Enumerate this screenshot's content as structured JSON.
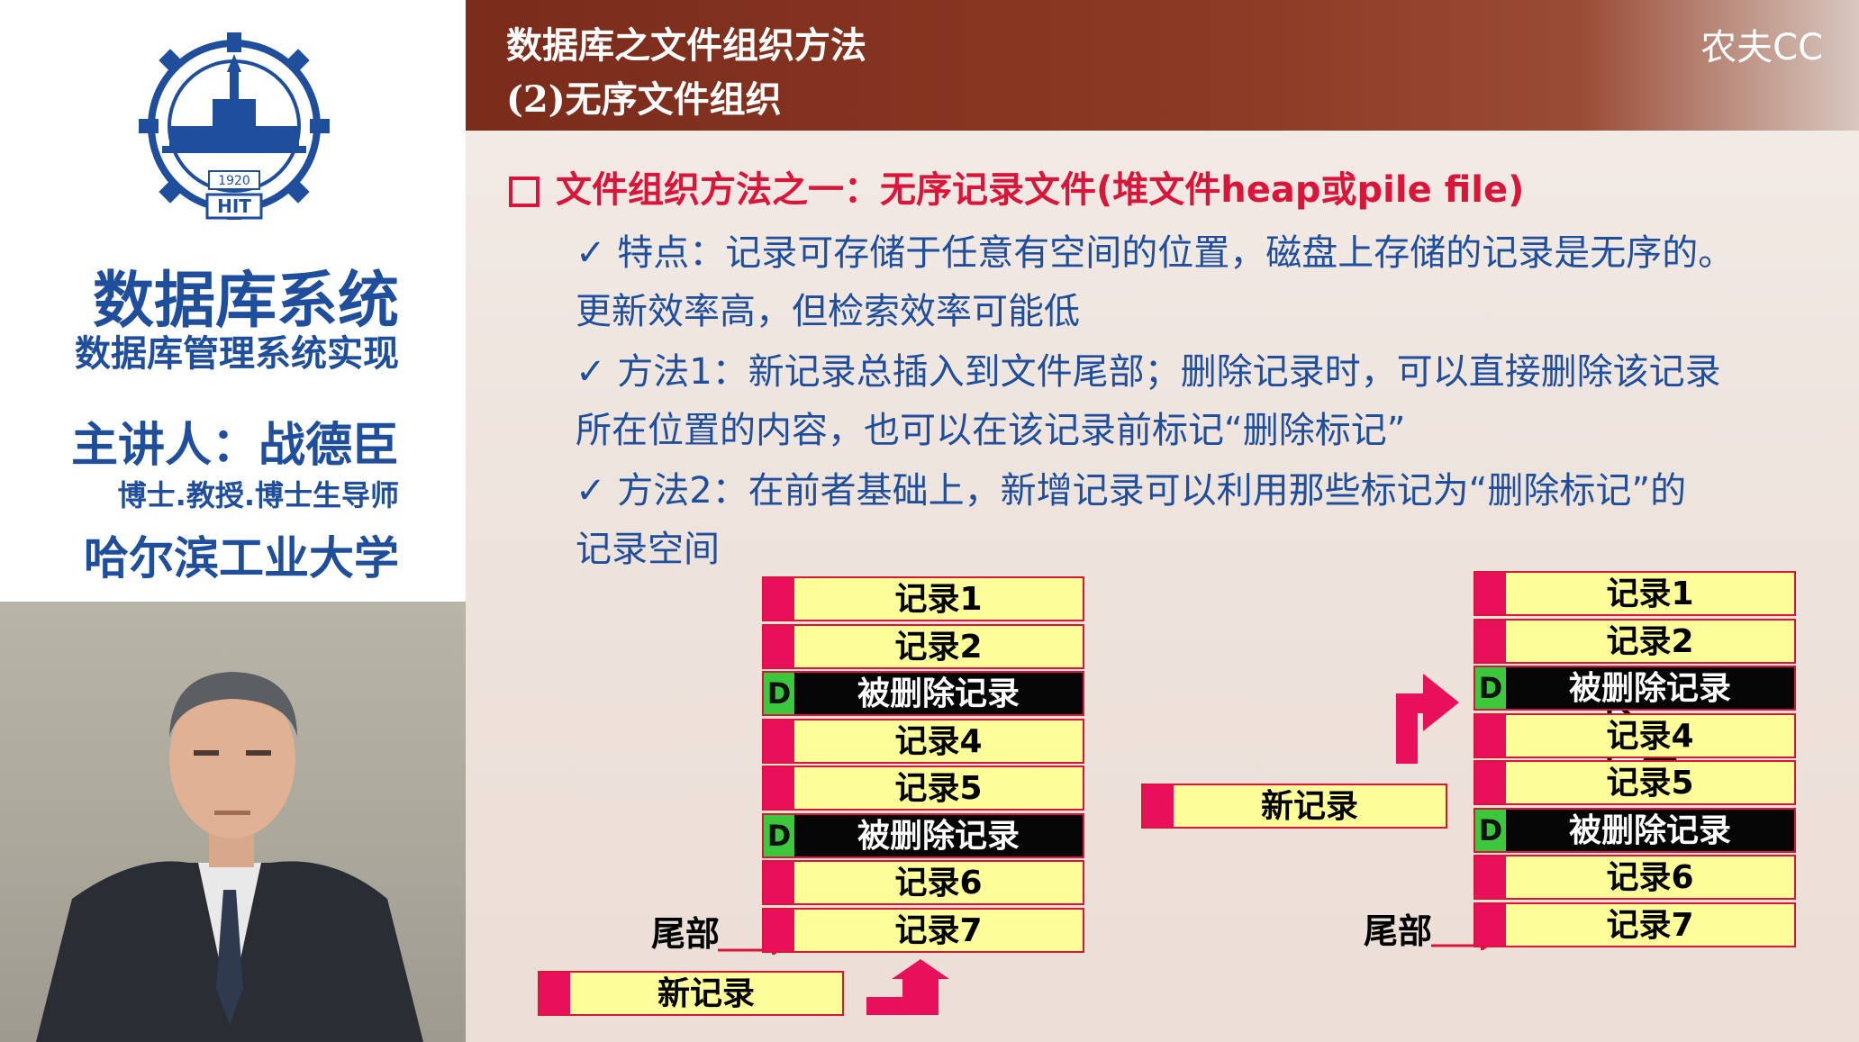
{
  "sidebar": {
    "title": "数据库系统",
    "subtitle": "数据库管理系统实现",
    "lecturer": "主讲人：战德臣",
    "credentials": "博士.教授.博士生导师",
    "university": "哈尔滨工业大学",
    "logo_text": {
      "year": "1920",
      "name": "HIT"
    }
  },
  "slide": {
    "banner_line1": "数据库之文件组织方法",
    "banner_line2": "(2)无序文件组织",
    "watermark": "农夫CC",
    "heading": "文件组织方法之一：无序记录文件(堆文件heap或pile file)",
    "bullets": [
      {
        "line1": "✓ 特点：记录可存储于任意有空间的位置，磁盘上存储的记录是无序的。",
        "line2": "更新效率高，但检索效率可能低"
      },
      {
        "line1": "✓ 方法1：新记录总插入到文件尾部；删除记录时，可以直接删除该记录",
        "line2": "所在位置的内容，也可以在该记录前标记“删除标记”"
      },
      {
        "line1": "✓ 方法2：在前者基础上，新增记录可以利用那些标记为“删除标记”的",
        "line2": "记录空间"
      }
    ]
  },
  "diagram_left": {
    "records": [
      {
        "text": "记录1",
        "deleted": false
      },
      {
        "text": "记录2",
        "deleted": false
      },
      {
        "text": "被删除记录",
        "deleted": true,
        "mark": "D"
      },
      {
        "text": "记录4",
        "deleted": false
      },
      {
        "text": "记录5",
        "deleted": false
      },
      {
        "text": "被删除记录",
        "deleted": true,
        "mark": "D"
      },
      {
        "text": "记录6",
        "deleted": false
      },
      {
        "text": "记录7",
        "deleted": false
      }
    ],
    "tail_label": "尾部",
    "new_record": "新记录"
  },
  "diagram_right": {
    "records": [
      {
        "text": "记录1",
        "deleted": false
      },
      {
        "text": "记录2",
        "deleted": false
      },
      {
        "text": "被删除记录",
        "deleted": true,
        "mark": "D"
      },
      {
        "text": "记录4",
        "deleted": false
      },
      {
        "text": "记录5",
        "deleted": false
      },
      {
        "text": "被删除记录",
        "deleted": true,
        "mark": "D"
      },
      {
        "text": "记录6",
        "deleted": false
      },
      {
        "text": "记录7",
        "deleted": false
      }
    ],
    "tail_label": "尾部",
    "new_record": "新记录"
  },
  "colors": {
    "accent_red": "#d9163a",
    "text_blue": "#1f4e9c",
    "banner": "#7a2b1a",
    "record_fill": "#fdfd9a",
    "deleted_mark": "#3cc83c"
  }
}
